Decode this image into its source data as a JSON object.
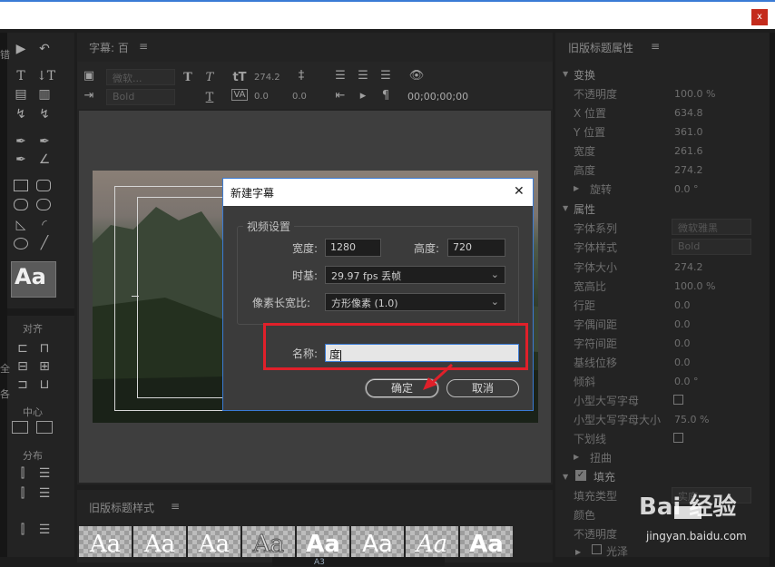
{
  "window": {
    "close_label": "x"
  },
  "tools_panel": {
    "aa_label": "Aa",
    "align_label": "对齐",
    "center_label": "中心",
    "distribute_label": "分布",
    "left_cut_1": "错",
    "left_cut_2": "全",
    "left_cut_3": "各"
  },
  "caption_panel": {
    "title": "字幕: 百",
    "menu_icon": "≡",
    "font_family": "微软...",
    "font_style": "Bold",
    "size_value": "274.2",
    "kern_value": "0.0",
    "tracking_value": "0.0",
    "timecode": "00;00;00;00"
  },
  "properties_panel": {
    "title": "旧版标题属性",
    "transform_section": "变换",
    "rows": [
      {
        "name": "不透明度",
        "value": "100.0 %"
      },
      {
        "name": "X 位置",
        "value": "634.8"
      },
      {
        "name": "Y 位置",
        "value": "361.0"
      },
      {
        "name": "宽度",
        "value": "261.6"
      },
      {
        "name": "高度",
        "value": "274.2"
      },
      {
        "name": "旋转",
        "value": "0.0 °"
      }
    ],
    "attributes_section": "属性",
    "font_family_name": "字体系列",
    "font_family_value": "微软雅黑",
    "font_style_name": "字体样式",
    "font_style_value": "Bold",
    "attr_rows": [
      {
        "name": "字体大小",
        "value": "274.2"
      },
      {
        "name": "宽高比",
        "value": "100.0 %"
      },
      {
        "name": "行距",
        "value": "0.0"
      },
      {
        "name": "字偶间距",
        "value": "0.0"
      },
      {
        "name": "字符间距",
        "value": "0.0"
      },
      {
        "name": "基线位移",
        "value": "0.0"
      },
      {
        "name": "倾斜",
        "value": "0.0 °"
      }
    ],
    "small_caps": "小型大写字母",
    "small_caps_size": "小型大写字母大小",
    "small_caps_size_value": "75.0 %",
    "underline": "下划线",
    "distort": "扭曲",
    "fill_section": "填充",
    "fill_type_name": "填充类型",
    "fill_type_value": "实底",
    "color_name": "颜色",
    "opacity_name": "不透明度",
    "gloss_name": "光泽"
  },
  "styles_panel": {
    "title": "旧版标题样式",
    "menu_icon": "≡",
    "tiles": [
      "Aa",
      "Aa",
      "Aa",
      "Aa",
      "Aa",
      "Aa",
      "Aa",
      "Aa"
    ]
  },
  "dialog": {
    "title": "新建字幕",
    "close_icon": "✕",
    "group_label": "视频设置",
    "width_label": "宽度:",
    "width_value": "1280",
    "height_label": "高度:",
    "height_value": "720",
    "timebase_label": "时基:",
    "timebase_value": "29.97 fps 丢帧",
    "aspect_label": "像素长宽比:",
    "aspect_value": "方形像素 (1.0)",
    "name_label": "名称:",
    "name_value": "度",
    "ok_label": "确定",
    "cancel_label": "取消"
  },
  "watermark": {
    "brand": "Bai 经验",
    "url": "jingyan.baidu.com"
  },
  "bottom_bar": {
    "a3_label": "A3"
  },
  "colors": {
    "highlight": "#e0202a",
    "accent": "#3a7bd5",
    "panel": "#232323"
  }
}
